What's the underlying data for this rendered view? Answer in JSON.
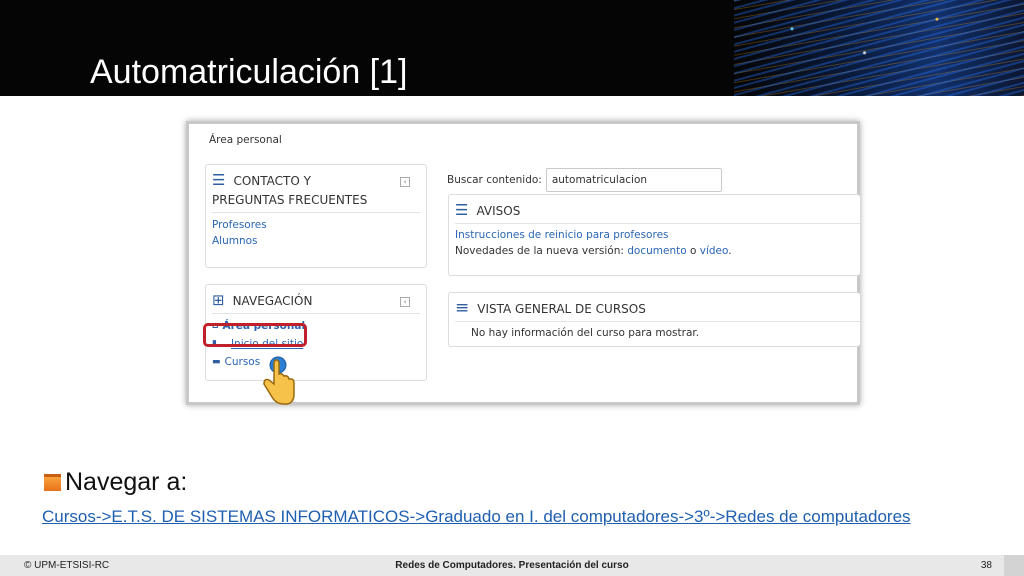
{
  "slide": {
    "title": "Automatriculación [1]",
    "bullet": "Navegar a:",
    "path_link": "Cursos->E.T.S. DE SISTEMAS INFORMATICOS->Graduado en I. del computadores->3º->Redes de computadores"
  },
  "screenshot": {
    "breadcrumb": "Área personal",
    "contact_block": {
      "title_line1": "CONTACTO Y",
      "title_line2": "PREGUNTAS FRECUENTES",
      "links": [
        "Profesores",
        "Alumnos"
      ]
    },
    "nav_block": {
      "title": "NAVEGACIÓN",
      "items": [
        "Área personal",
        "Inicio del sitio",
        "Cursos"
      ]
    },
    "search": {
      "label": "Buscar contenido:",
      "value": "automatriculacion"
    },
    "avisos": {
      "title": "AVISOS",
      "link1": "Instrucciones de reinicio para profesores",
      "text_prefix": "Novedades de la nueva versión: ",
      "doc_link": "documento",
      "conj": " o ",
      "video_link": "vídeo",
      "suffix": "."
    },
    "overview": {
      "title": "VISTA GENERAL DE CURSOS",
      "message": "No hay información del curso para mostrar."
    },
    "icons": {
      "list": "list-icon",
      "sitemap": "sitemap-icon",
      "menu": "menu-icon",
      "home": "home-icon",
      "file": "file-icon",
      "folder": "folder-icon",
      "hand": "pointer-hand-icon"
    },
    "highlight_color": "#c0202a"
  },
  "footer": {
    "left": "© UPM-ETSISI-RC",
    "center": "Redes de Computadores. Presentación del curso",
    "page": "38"
  }
}
